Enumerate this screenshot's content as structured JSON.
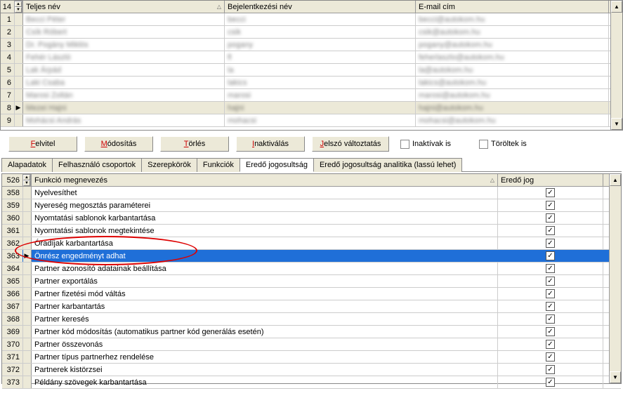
{
  "user_table": {
    "count_label": "14",
    "headers": {
      "fullname": "Teljes név",
      "login": "Bejelentkezési név",
      "email": "E-mail cím"
    },
    "rows": [
      {
        "idx": "1",
        "fullname": "Becci Péter",
        "login": "becci",
        "email": "becci@autokom.hu",
        "marker": ""
      },
      {
        "idx": "2",
        "fullname": "Csík Róbert",
        "login": "csik",
        "email": "csik@autokom.hu",
        "marker": ""
      },
      {
        "idx": "3",
        "fullname": "Dr. Pogány Miklós",
        "login": "pogany",
        "email": "pogany@autokom.hu",
        "marker": ""
      },
      {
        "idx": "4",
        "fullname": "Fehér László",
        "login": "fl",
        "email": "feherlaszlo@autokom.hu",
        "marker": ""
      },
      {
        "idx": "5",
        "fullname": "Lak Árpád",
        "login": "la",
        "email": "la@autokom.hu",
        "marker": ""
      },
      {
        "idx": "6",
        "fullname": "Laki Csaba",
        "login": "lakics",
        "email": "lakics@autokom.hu",
        "marker": ""
      },
      {
        "idx": "7",
        "fullname": "Marosi Zoltán",
        "login": "marosi",
        "email": "marosi@autokom.hu",
        "marker": ""
      },
      {
        "idx": "8",
        "fullname": "Mezei Hajni",
        "login": "hajni",
        "email": "hajni@autokom.hu",
        "marker": "▶"
      },
      {
        "idx": "9",
        "fullname": "Mohácsi András",
        "login": "mohacsi",
        "email": "mohacsi@autokom.hu",
        "marker": ""
      }
    ]
  },
  "buttons": {
    "felvitel": {
      "u": "F",
      "rest": "elvitel"
    },
    "modositas": {
      "u": "M",
      "rest": "ódosítás"
    },
    "torles": {
      "u": "T",
      "rest": "örlés"
    },
    "inaktivalas": {
      "u": "I",
      "rest": "naktiválás"
    },
    "jelszo": {
      "u": "J",
      "rest": "elszó változtatás"
    }
  },
  "checkboxes": {
    "inaktivak": "Inaktívak is",
    "toroltek": "Töröltek is"
  },
  "tabs": [
    {
      "label": "Alapadatok",
      "active": false
    },
    {
      "label": "Felhasználó csoportok",
      "active": false
    },
    {
      "label": "Szerepkörök",
      "active": false
    },
    {
      "label": "Funkciók",
      "active": false
    },
    {
      "label": "Eredő jogosultság",
      "active": true
    },
    {
      "label": "Eredő jogosultság analitika (lassú lehet)",
      "active": false
    }
  ],
  "func_table": {
    "count_label": "526",
    "headers": {
      "name": "Funkció megnevezés",
      "jog": "Eredő jog"
    },
    "rows": [
      {
        "idx": "358",
        "name": "Nyelvesíthet",
        "checked": true,
        "sel": false
      },
      {
        "idx": "359",
        "name": "Nyereség megosztás paraméterei",
        "checked": true,
        "sel": false
      },
      {
        "idx": "360",
        "name": "Nyomtatási sablonok karbantartása",
        "checked": true,
        "sel": false
      },
      {
        "idx": "361",
        "name": "Nyomtatási sablonok megtekintése",
        "checked": true,
        "sel": false
      },
      {
        "idx": "362",
        "name": "Óradíjak karbantartása",
        "checked": true,
        "sel": false
      },
      {
        "idx": "363",
        "name": "Önrész engedményt adhat",
        "checked": true,
        "sel": true,
        "marker": "▶"
      },
      {
        "idx": "364",
        "name": "Partner azonosító adatainak beállítása",
        "checked": true,
        "sel": false
      },
      {
        "idx": "365",
        "name": "Partner exportálás",
        "checked": true,
        "sel": false
      },
      {
        "idx": "366",
        "name": "Partner fizetési mód váltás",
        "checked": true,
        "sel": false
      },
      {
        "idx": "367",
        "name": "Partner karbantartás",
        "checked": true,
        "sel": false
      },
      {
        "idx": "368",
        "name": "Partner keresés",
        "checked": true,
        "sel": false
      },
      {
        "idx": "369",
        "name": "Partner kód módosítás (automatikus partner kód generálás esetén)",
        "checked": true,
        "sel": false
      },
      {
        "idx": "370",
        "name": "Partner összevonás",
        "checked": true,
        "sel": false
      },
      {
        "idx": "371",
        "name": "Partner típus partnerhez rendelése",
        "checked": true,
        "sel": false
      },
      {
        "idx": "372",
        "name": "Partnerek kistörzsei",
        "checked": true,
        "sel": false
      },
      {
        "idx": "373",
        "name": "Példány szövegek karbantartása",
        "checked": true,
        "sel": false
      }
    ]
  }
}
